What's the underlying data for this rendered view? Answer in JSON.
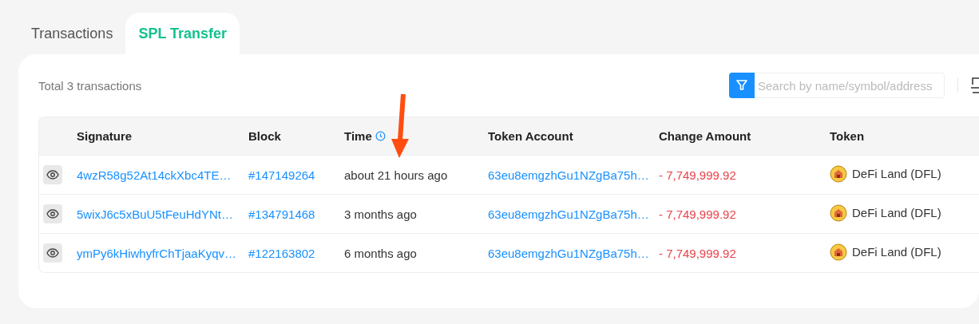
{
  "tabs": [
    {
      "label": "Transactions",
      "selected": false
    },
    {
      "label": "SPL Transfer",
      "selected": true
    }
  ],
  "summary": "Total 3 transactions",
  "search": {
    "placeholder": "Search by name/symbol/address"
  },
  "table": {
    "columns": [
      "Signature",
      "Block",
      "Time",
      "Token Account",
      "Change Amount",
      "Token"
    ],
    "rows": [
      {
        "signature": "4wzR58g52At14ckXbc4TE…",
        "block": "#147149264",
        "time": "about 21 hours ago",
        "token_account": "63eu8emgzhGu1NZgBa75h…",
        "change_amount": "- 7,749,999.92",
        "token": "DeFi Land (DFL)"
      },
      {
        "signature": "5wixJ6c5xBuU5tFeuHdYNt…",
        "block": "#134791468",
        "time": "3 months ago",
        "token_account": "63eu8emgzhGu1NZgBa75h…",
        "change_amount": "- 7,749,999.92",
        "token": "DeFi Land (DFL)"
      },
      {
        "signature": "ymPy6kHiwhyfrChTjaaKyqv…",
        "block": "#122163802",
        "time": "6 months ago",
        "token_account": "63eu8emgzhGu1NZgBa75h…",
        "change_amount": "- 7,749,999.92",
        "token": "DeFi Land (DFL)"
      }
    ]
  }
}
